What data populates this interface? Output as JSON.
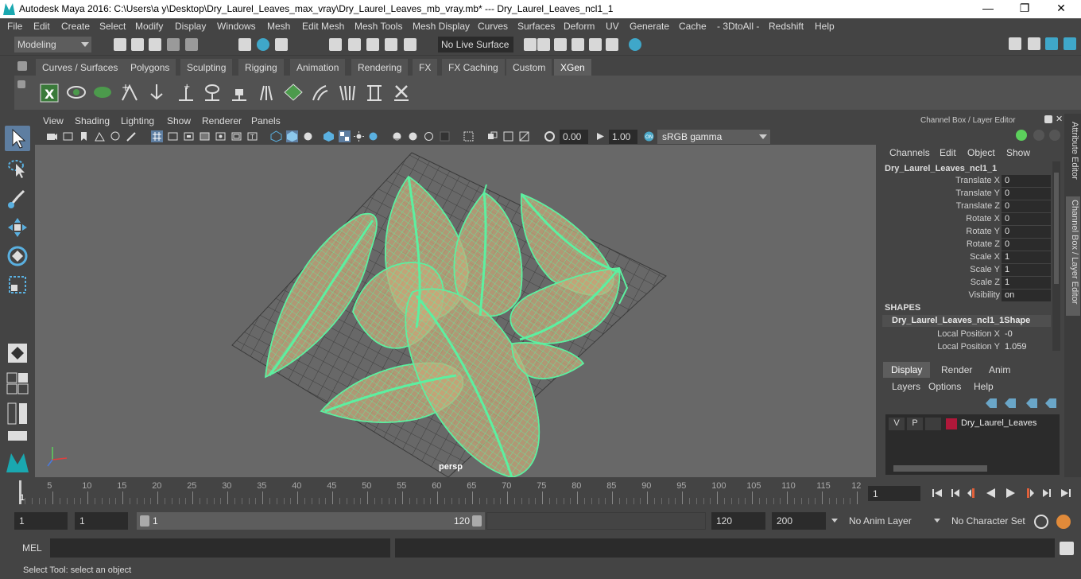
{
  "window": {
    "title": "Autodesk Maya 2016: C:\\Users\\a y\\Desktop\\Dry_Laurel_Leaves_max_vray\\Dry_Laurel_Leaves_mb_vray.mb*   ---   Dry_Laurel_Leaves_ncl1_1",
    "minimize": "—",
    "maximize": "❐",
    "close": "✕"
  },
  "menubar": [
    "File",
    "Edit",
    "Create",
    "Select",
    "Modify",
    "Display",
    "Windows",
    "Mesh",
    "Edit Mesh",
    "Mesh Tools",
    "Mesh Display",
    "Curves",
    "Surfaces",
    "Deform",
    "UV",
    "Generate",
    "Cache",
    "- 3DtoAll -",
    "Redshift",
    "Help"
  ],
  "status": {
    "mode": "Modeling",
    "live_surface": "No Live Surface"
  },
  "shelf_tabs": [
    "Curves / Surfaces",
    "Polygons",
    "Sculpting",
    "Rigging",
    "Animation",
    "Rendering",
    "FX",
    "FX Caching",
    "Custom",
    "XGen"
  ],
  "active_shelf_tab": "XGen",
  "viewport_menu": [
    "View",
    "Shading",
    "Lighting",
    "Show",
    "Renderer",
    "Panels"
  ],
  "viewport_toolbar": {
    "exposure": "0.00",
    "gamma": "1.00",
    "color_space": "sRGB gamma"
  },
  "viewport": {
    "camera_label": "persp",
    "wire_color": "#5cf0a0",
    "bg_color": "#686868"
  },
  "channel_box": {
    "panel_title": "Channel Box / Layer Editor",
    "menus": [
      "Channels",
      "Edit",
      "Object",
      "Show"
    ],
    "object_name": "Dry_Laurel_Leaves_ncl1_1",
    "attributes": [
      {
        "name": "Translate X",
        "value": "0"
      },
      {
        "name": "Translate Y",
        "value": "0"
      },
      {
        "name": "Translate Z",
        "value": "0"
      },
      {
        "name": "Rotate X",
        "value": "0"
      },
      {
        "name": "Rotate Y",
        "value": "0"
      },
      {
        "name": "Rotate Z",
        "value": "0"
      },
      {
        "name": "Scale X",
        "value": "1"
      },
      {
        "name": "Scale Y",
        "value": "1"
      },
      {
        "name": "Scale Z",
        "value": "1"
      },
      {
        "name": "Visibility",
        "value": "on"
      }
    ],
    "shapes_header": "SHAPES",
    "shape_name": "Dry_Laurel_Leaves_ncl1_1Shape",
    "shape_attributes": [
      {
        "name": "Local Position X",
        "value": "-0"
      },
      {
        "name": "Local Position Y",
        "value": "1.059"
      }
    ]
  },
  "layer_editor": {
    "tabs": [
      "Display",
      "Render",
      "Anim"
    ],
    "active_tab": "Display",
    "menus": [
      "Layers",
      "Options",
      "Help"
    ],
    "layer": {
      "v": "V",
      "p": "P",
      "name": "Dry_Laurel_Leaves",
      "color": "#b0183a"
    }
  },
  "side_tabs": [
    "Attribute Editor",
    "Channel Box / Layer Editor"
  ],
  "timeline": {
    "ticks": [
      "5",
      "10",
      "15",
      "20",
      "25",
      "30",
      "35",
      "40",
      "45",
      "50",
      "55",
      "60",
      "65",
      "70",
      "75",
      "80",
      "85",
      "90",
      "95",
      "100",
      "105",
      "110",
      "115",
      "12"
    ],
    "current": "1",
    "current_field": "1"
  },
  "range": {
    "start": "1",
    "playback_start": "1",
    "slider_start": "1",
    "slider_end": "120",
    "playback_end": "120",
    "end": "200",
    "anim_layer": "No Anim Layer",
    "character_set": "No Character Set"
  },
  "command_line": {
    "label": "MEL"
  },
  "help_line": "Select Tool: select an object"
}
